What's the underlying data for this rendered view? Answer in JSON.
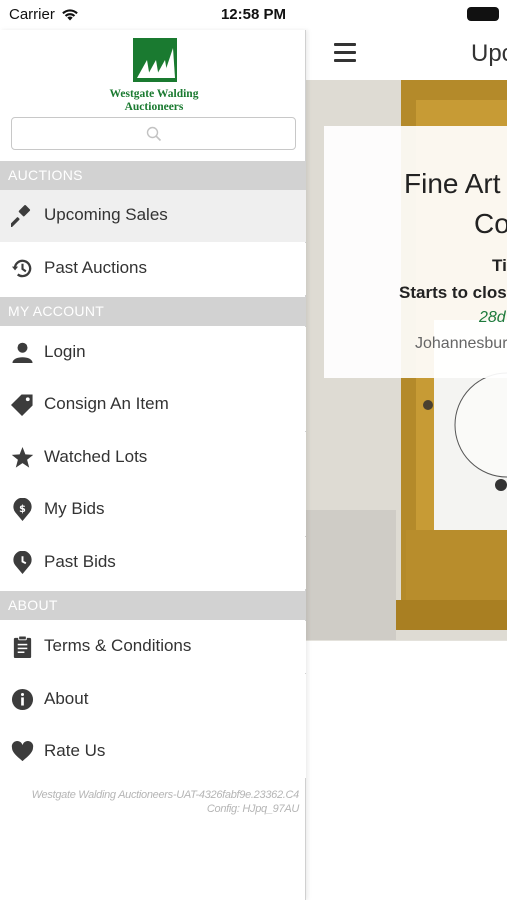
{
  "status_bar": {
    "carrier": "Carrier",
    "time": "12:58 PM",
    "icons": [
      "wifi-icon",
      "battery-icon"
    ]
  },
  "brand": {
    "name": "Westgate Walding Auctioneers",
    "color": "#1a7a30"
  },
  "search": {
    "placeholder": ""
  },
  "drawer": {
    "sections": [
      {
        "label": "AUCTIONS",
        "items": [
          {
            "label": "Upcoming Sales",
            "icon": "gavel-icon",
            "active": true
          },
          {
            "label": "Past Auctions",
            "icon": "history-icon",
            "active": false
          }
        ]
      },
      {
        "label": "MY ACCOUNT",
        "items": [
          {
            "label": "Login",
            "icon": "user-icon"
          },
          {
            "label": "Consign An Item",
            "icon": "tag-icon"
          },
          {
            "label": "Watched Lots",
            "icon": "star-icon"
          },
          {
            "label": "My Bids",
            "icon": "bid-pin-icon"
          },
          {
            "label": "Past Bids",
            "icon": "clock-pin-icon"
          }
        ]
      },
      {
        "label": "ABOUT",
        "items": [
          {
            "label": "Terms & Conditions",
            "icon": "clipboard-icon"
          },
          {
            "label": "About",
            "icon": "info-icon"
          },
          {
            "label": "Rate Us",
            "icon": "heart-icon"
          }
        ]
      }
    ],
    "footer": {
      "line1": "Westgate Walding Auctioneers-UAT-4326fabf9e.23362.C4",
      "line2": "Config: HJpq_97AU"
    }
  },
  "main": {
    "title": "Upc",
    "card": {
      "title_line1": "Fine Art",
      "title_line2": "Co",
      "line_ti": "Ti",
      "starts": "Starts to close",
      "date": "28d",
      "location": "Johannesbur"
    }
  },
  "colors": {
    "section_bg": "#d2d2d2",
    "active_item_bg": "#efefef",
    "icon": "#3c3c3c",
    "date_green": "#1e7a3c"
  }
}
